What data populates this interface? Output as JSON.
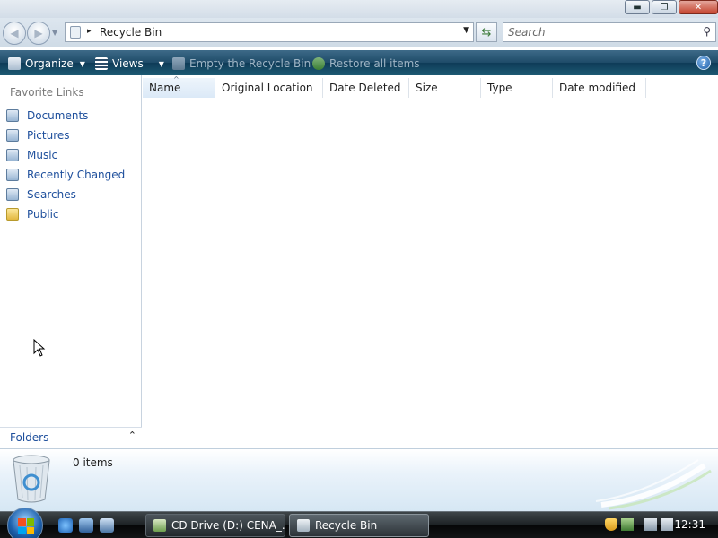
{
  "window": {
    "minimize_glyph": "▬",
    "maximize_glyph": "❐",
    "close_glyph": "✕"
  },
  "address": {
    "breadcrumb_sep": "▸",
    "crumb": "Recycle Bin",
    "dropdown_glyph": "▼",
    "back_glyph": "◀",
    "forward_glyph": "▶",
    "nav_dropdown_glyph": "▼",
    "refresh_glyph": "⇆"
  },
  "search": {
    "placeholder": "Search",
    "icon": "search-icon"
  },
  "commandbar": {
    "organize_label": "Organize",
    "views_label": "Views",
    "empty_label": "Empty the Recycle Bin",
    "restore_label": "Restore all items",
    "caret": "▼",
    "help_glyph": "?"
  },
  "navpane": {
    "header": "Favorite Links",
    "items": [
      {
        "label": "Documents",
        "icon": "documents-icon"
      },
      {
        "label": "Pictures",
        "icon": "pictures-icon"
      },
      {
        "label": "Music",
        "icon": "music-icon"
      },
      {
        "label": "Recently Changed",
        "icon": "recently-changed-icon"
      },
      {
        "label": "Searches",
        "icon": "searches-icon"
      },
      {
        "label": "Public",
        "icon": "folder-icon"
      }
    ],
    "folders_label": "Folders",
    "folders_chevron": "⌃"
  },
  "filelist": {
    "columns": [
      "Name",
      "Original Location",
      "Date Deleted",
      "Size",
      "Type",
      "Date modified"
    ],
    "sort_arrow": "^"
  },
  "details": {
    "count": "0 items"
  },
  "taskbar": {
    "tasks": [
      {
        "label": "CD Drive (D:) CENA_..."
      },
      {
        "label": "Recycle Bin"
      }
    ],
    "clock": "12:31"
  },
  "colors": {
    "link": "#1e4f9c",
    "commandbar": "#1e4b68",
    "taskbar": "#121416"
  }
}
